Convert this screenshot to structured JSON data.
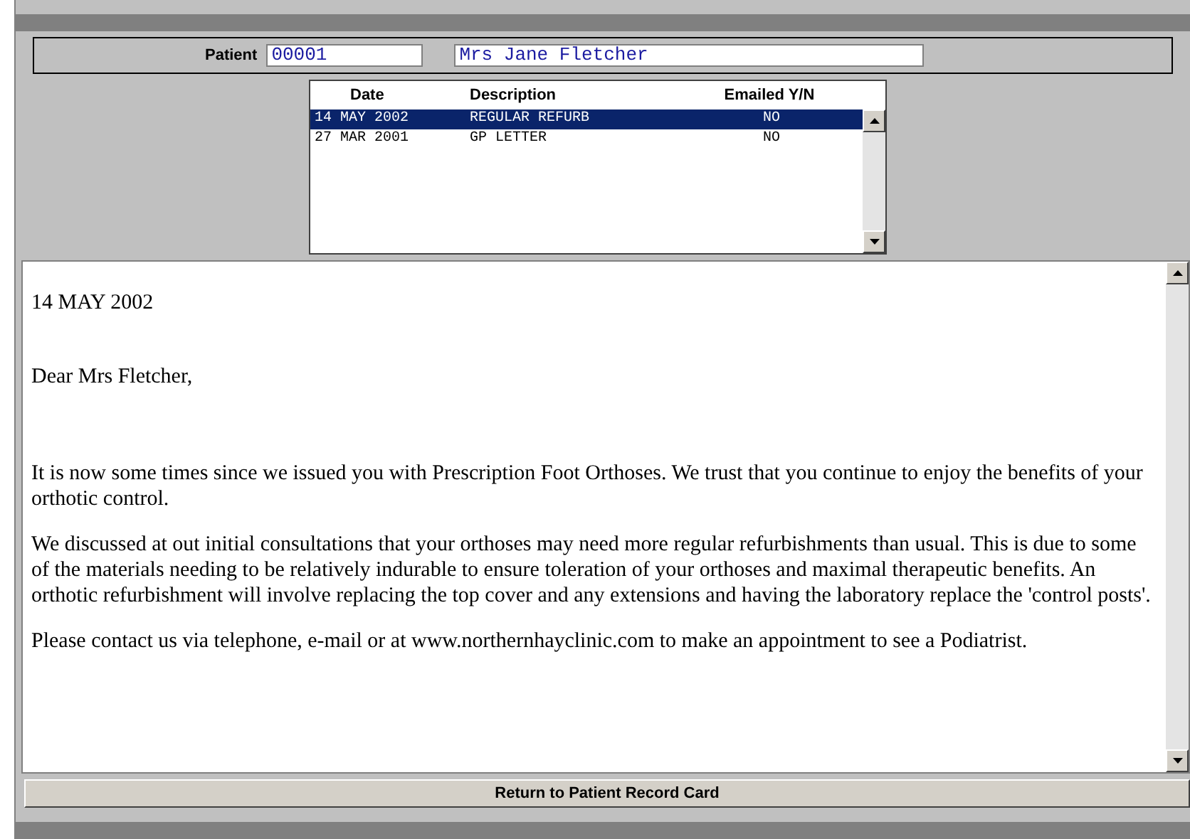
{
  "patient": {
    "label": "Patient",
    "number": "00001",
    "name": "Mrs Jane Fletcher"
  },
  "letters": {
    "columns": [
      "Date",
      "Description",
      "Emailed Y/N"
    ],
    "rows": [
      {
        "date": "14 MAY 2002",
        "description": "REGULAR REFURB",
        "emailed": "NO",
        "selected": true
      },
      {
        "date": "27 MAR 2001",
        "description": "GP LETTER",
        "emailed": "NO",
        "selected": false
      }
    ]
  },
  "letter_text": [
    "14 MAY 2002",
    "Dear Mrs Fletcher,",
    "It is now some times since we issued you with Prescription Foot Orthoses. We trust that  you continue to enjoy the benefits of your orthotic control.",
    "We discussed at out initial consultations that your orthoses may need more regular refurbishments than usual. This is due to some of the materials needing to be relatively indurable to ensure toleration of your orthoses and maximal therapeutic benefits. An orthotic refurbishment  will involve replacing the top cover and any extensions and having the laboratory replace the 'control posts'.",
    "Please contact us via telephone, e-mail or at www.northernhayclinic.com  to make an appointment to see a Podiatrist."
  ],
  "return_button": "Return to Patient Record Card"
}
